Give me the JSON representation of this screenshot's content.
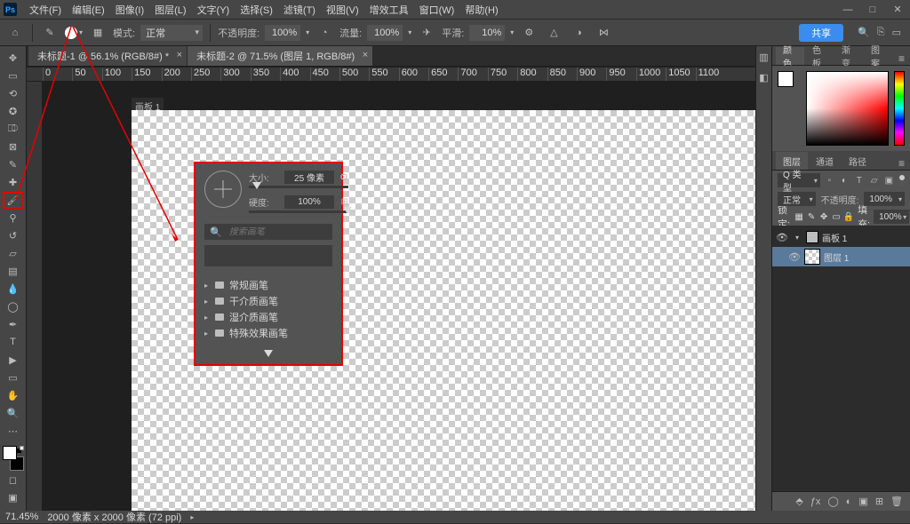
{
  "menu": {
    "items": [
      "文件(F)",
      "编辑(E)",
      "图像(I)",
      "图层(L)",
      "文字(Y)",
      "选择(S)",
      "滤镜(T)",
      "视图(V)",
      "增效工具",
      "窗口(W)",
      "帮助(H)"
    ]
  },
  "optbar": {
    "mode_label": "模式:",
    "mode_value": "正常",
    "opacity_label": "不透明度:",
    "opacity_value": "100%",
    "flow_label": "流量:",
    "flow_value": "100%",
    "smoothing_label": "平滑:",
    "smoothing_value": "10%",
    "share": "共享"
  },
  "tabs": [
    {
      "label": "未标题-1 @ 56.1% (RGB/8#) *"
    },
    {
      "label": "未标题-2 @ 71.5% (图层 1, RGB/8#)"
    }
  ],
  "artboard": "画板 1",
  "brushpop": {
    "size_label": "大小:",
    "size_value": "25 像素",
    "hard_label": "硬度:",
    "hard_value": "100%",
    "search_ph": "搜索画笔",
    "folders": [
      "常规画笔",
      "干介质画笔",
      "湿介质画笔",
      "特殊效果画笔"
    ]
  },
  "panels": {
    "color": {
      "tabs": [
        "颜色",
        "色板",
        "渐变",
        "图案"
      ]
    },
    "layers": {
      "tabs": [
        "图层",
        "通道",
        "路径"
      ],
      "kind": "Q 类型",
      "blend": "正常",
      "opacity_label": "不透明度:",
      "opacity_value": "100%",
      "lock_label": "锁定:",
      "fill_label": "填充:",
      "fill_value": "100%",
      "items": [
        {
          "name": "画板 1",
          "type": "artboard"
        },
        {
          "name": "图层 1",
          "type": "layer"
        }
      ]
    }
  },
  "status": {
    "zoom": "71.45%",
    "docinfo": "2000 像素 x 2000 像素 (72 ppi)"
  },
  "ruler": [
    "0",
    "50",
    "100",
    "150",
    "200",
    "250",
    "300",
    "350",
    "400",
    "450",
    "500",
    "550",
    "600",
    "650",
    "700",
    "750",
    "800",
    "850",
    "900",
    "950",
    "1000",
    "1050",
    "1100"
  ]
}
